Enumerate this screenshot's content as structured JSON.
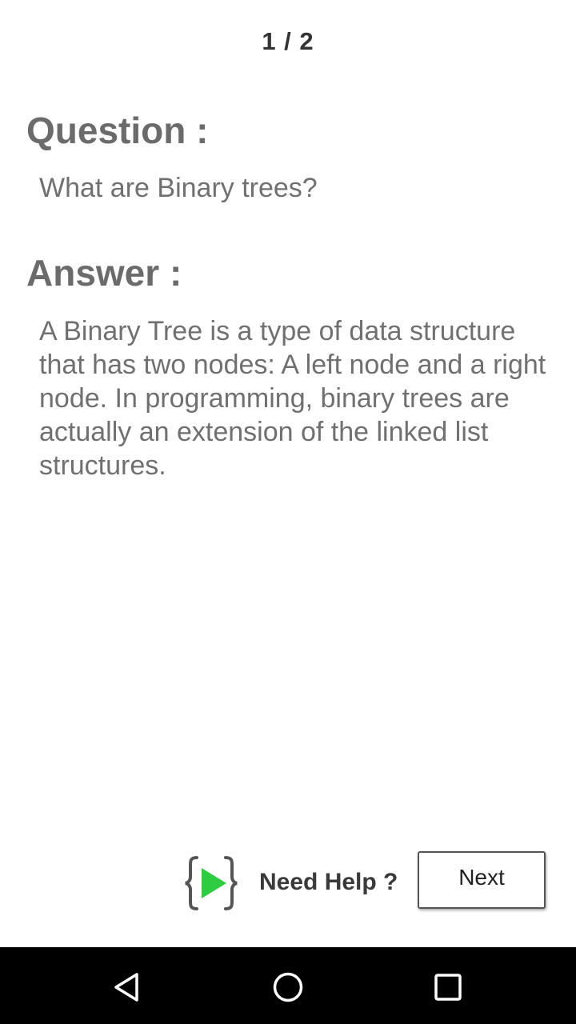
{
  "progress": "1 / 2",
  "question": {
    "heading": "Question :",
    "text": "What are Binary trees?"
  },
  "answer": {
    "heading": "Answer :",
    "text": "A Binary Tree is a type of data structure that has two nodes: A left node and a right node. In programming, binary trees are actually an extension of the linked list structures."
  },
  "footer": {
    "help_label": "Need Help ?",
    "help_icon": "code-braces-play-icon",
    "next_label": "Next"
  },
  "system_nav": {
    "back_icon": "back-triangle-icon",
    "home_icon": "home-circle-icon",
    "recents_icon": "recents-square-icon"
  },
  "colors": {
    "heading": "#6b6b6b",
    "body": "#707070",
    "play_green": "#2ecc40",
    "navbar": "#000000"
  }
}
